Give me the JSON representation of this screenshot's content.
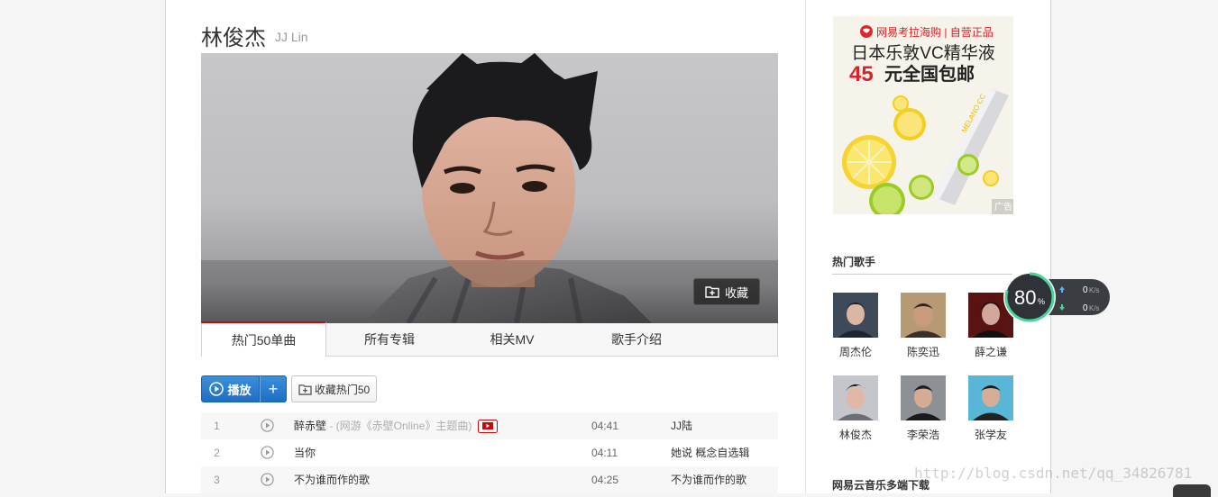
{
  "artist": {
    "name": "林俊杰",
    "alias": "JJ Lin"
  },
  "cover": {
    "collect_label": "收藏"
  },
  "tabs": [
    {
      "label": "热门50单曲",
      "active": true
    },
    {
      "label": "所有专辑",
      "active": false
    },
    {
      "label": "相关MV",
      "active": false
    },
    {
      "label": "歌手介绍",
      "active": false
    }
  ],
  "actions": {
    "play_label": "播放",
    "add_label": "+",
    "collect_top50_label": "收藏热门50"
  },
  "songs": [
    {
      "num": "1",
      "title": "醉赤壁",
      "subtitle": " - (网游《赤壁Online》主题曲)",
      "has_mv": true,
      "duration": "04:41",
      "album": "JJ陆"
    },
    {
      "num": "2",
      "title": "当你",
      "subtitle": "",
      "has_mv": false,
      "duration": "04:11",
      "album": "她说 概念自选辑"
    },
    {
      "num": "3",
      "title": "不为谁而作的歌",
      "subtitle": "",
      "has_mv": false,
      "duration": "04:25",
      "album": "不为谁而作的歌"
    }
  ],
  "ad": {
    "brand": "网易考拉海购 | 自营正品",
    "line1": "日本乐敦VC精华液",
    "price": "45",
    "line2": "元全国包邮",
    "product_text": "MELANO CC",
    "tag": "广告"
  },
  "hot_singers": {
    "title": "热门歌手",
    "items": [
      {
        "name": "周杰伦"
      },
      {
        "name": "陈奕迅"
      },
      {
        "name": "薛之谦"
      },
      {
        "name": "林俊杰"
      },
      {
        "name": "李荣浩"
      },
      {
        "name": "张学友"
      }
    ]
  },
  "download_section": {
    "title": "网易云音乐多端下载"
  },
  "speed_widget": {
    "percent": "80",
    "percent_unit": "%",
    "up": "0",
    "down": "0",
    "unit": "K/s"
  },
  "watermark": "http://blog.csdn.net/qq_34826781",
  "colors": {
    "accent_red": "#c20c0c",
    "play_blue": "#2a7fd4"
  }
}
